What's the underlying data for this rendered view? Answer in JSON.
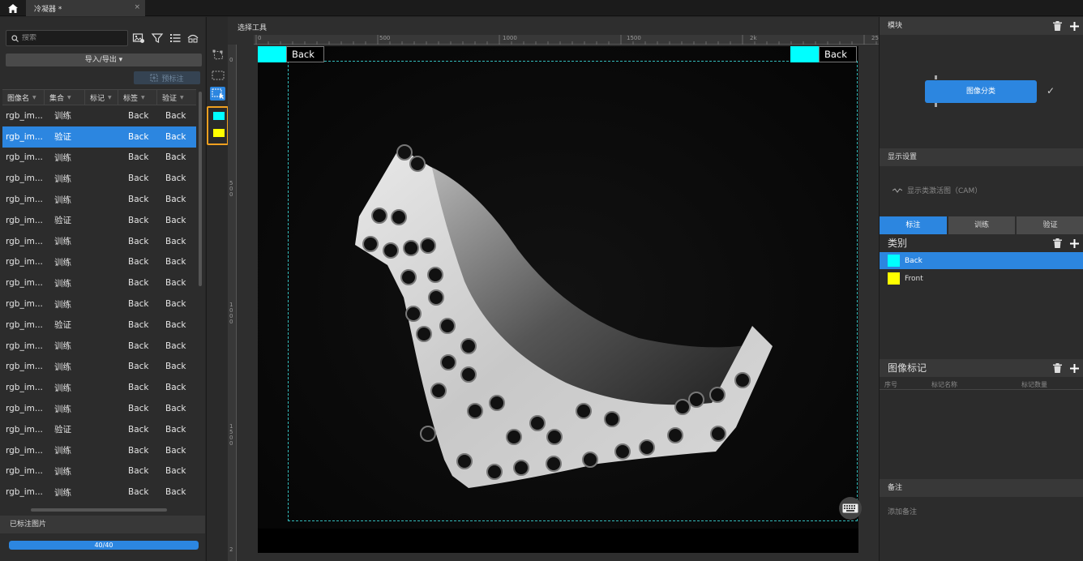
{
  "titlebar": {
    "tab_title": "冷凝器 *",
    "tab_close": "×"
  },
  "left": {
    "search_placeholder": "搜索",
    "import_export_label": "导入/导出 ▾",
    "prelabel_label": "预标注",
    "columns": [
      "图像名",
      "集合",
      "标记",
      "标签",
      "验证"
    ],
    "rows": [
      {
        "name": "rgb_im...",
        "set": "训练",
        "mark": "",
        "label": "Back",
        "verify": "Back"
      },
      {
        "name": "rgb_im...",
        "set": "验证",
        "mark": "",
        "label": "Back",
        "verify": "Back"
      },
      {
        "name": "rgb_im...",
        "set": "训练",
        "mark": "",
        "label": "Back",
        "verify": "Back"
      },
      {
        "name": "rgb_im...",
        "set": "训练",
        "mark": "",
        "label": "Back",
        "verify": "Back"
      },
      {
        "name": "rgb_im...",
        "set": "训练",
        "mark": "",
        "label": "Back",
        "verify": "Back"
      },
      {
        "name": "rgb_im...",
        "set": "验证",
        "mark": "",
        "label": "Back",
        "verify": "Back"
      },
      {
        "name": "rgb_im...",
        "set": "训练",
        "mark": "",
        "label": "Back",
        "verify": "Back"
      },
      {
        "name": "rgb_im...",
        "set": "训练",
        "mark": "",
        "label": "Back",
        "verify": "Back"
      },
      {
        "name": "rgb_im...",
        "set": "训练",
        "mark": "",
        "label": "Back",
        "verify": "Back"
      },
      {
        "name": "rgb_im...",
        "set": "训练",
        "mark": "",
        "label": "Back",
        "verify": "Back"
      },
      {
        "name": "rgb_im...",
        "set": "验证",
        "mark": "",
        "label": "Back",
        "verify": "Back"
      },
      {
        "name": "rgb_im...",
        "set": "训练",
        "mark": "",
        "label": "Back",
        "verify": "Back"
      },
      {
        "name": "rgb_im...",
        "set": "训练",
        "mark": "",
        "label": "Back",
        "verify": "Back"
      },
      {
        "name": "rgb_im...",
        "set": "训练",
        "mark": "",
        "label": "Back",
        "verify": "Back"
      },
      {
        "name": "rgb_im...",
        "set": "训练",
        "mark": "",
        "label": "Back",
        "verify": "Back"
      },
      {
        "name": "rgb_im...",
        "set": "验证",
        "mark": "",
        "label": "Back",
        "verify": "Back"
      },
      {
        "name": "rgb_im...",
        "set": "训练",
        "mark": "",
        "label": "Back",
        "verify": "Back"
      },
      {
        "name": "rgb_im...",
        "set": "训练",
        "mark": "",
        "label": "Back",
        "verify": "Back"
      },
      {
        "name": "rgb_im...",
        "set": "训练",
        "mark": "",
        "label": "Back",
        "verify": "Back"
      }
    ],
    "selected_row": 1,
    "labeled_header": "已标注图片",
    "progress_text": "40/40",
    "progress_fraction": 1.0
  },
  "canvas": {
    "title": "选择工具",
    "ruler_h": [
      "0",
      "500",
      "1000",
      "1500",
      "2k",
      "25"
    ],
    "ruler_v": [
      "0",
      "5\n0\n0",
      "1\n0\n0\n0",
      "1\n5\n0\n0",
      "2"
    ],
    "tag_left": "Back",
    "tag_right": "Back",
    "tag_color": "#00ffff"
  },
  "right": {
    "module_header": "模块",
    "module_node": "图像分类",
    "display_header": "显示设置",
    "cam_label": "显示类激活图（CAM）",
    "mode_tabs": [
      "标注",
      "训练",
      "验证"
    ],
    "class_header": "类别",
    "classes": [
      {
        "name": "Back",
        "color": "#00ffff"
      },
      {
        "name": "Front",
        "color": "#ffff00"
      }
    ],
    "imgmark_header": "图像标记",
    "imgmark_cols": [
      "序号",
      "标记名称",
      "标记数量"
    ],
    "note_header": "备注",
    "note_placeholder": "添加备注"
  },
  "colors": {
    "accent": "#2c86e0",
    "highlight_border": "#f0a020"
  }
}
